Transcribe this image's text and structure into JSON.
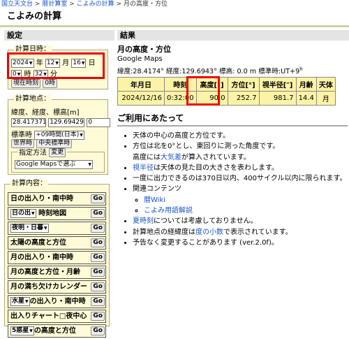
{
  "breadcrumb": {
    "items": [
      "国立天文台",
      "暦計算室",
      "こよみの計算"
    ],
    "sep": ">",
    "current": "月の高度・方位"
  },
  "page_title": "こよみの計算",
  "left_header": "設定",
  "right_header": "結果",
  "datetime": {
    "legend": "計算日時：",
    "year": "2024",
    "year_unit": "年",
    "month": "12",
    "month_unit": "月",
    "day": "16",
    "day_unit": "日",
    "hour": "0",
    "hour_unit": "時",
    "minute": "32",
    "minute_unit": "分",
    "now_button": "現在時刻",
    "zero_button": "0時"
  },
  "location": {
    "legend": "計算地点：",
    "label": "緯度、経度、標高[m]",
    "lat": "28.41737159",
    "lon": "129.6942901",
    "elev": "0",
    "tz_label": "標準時",
    "tz_value": "+09時間(日本)",
    "world_time_button": "世界時",
    "central_std_button": "中央標準時",
    "method_legend": "指定方法",
    "change_button": "変更",
    "method_value": "Google Mapsで選ぶ"
  },
  "contents": {
    "legend": "計算内容：",
    "go": "Go",
    "items": [
      {
        "label": "日の出入り・南中時",
        "select": ""
      },
      {
        "label": "時刻地図",
        "select": "日の出"
      },
      {
        "label": "",
        "select": "夜明・日暮"
      },
      {
        "label": "太陽の高度と方位",
        "select": ""
      },
      {
        "label": "月の出入り・南中時",
        "select": ""
      },
      {
        "label": "月の高度と方位・月齢",
        "select": ""
      },
      {
        "label": "月の満ち欠けカレンダー",
        "select": ""
      },
      {
        "label": "の出入り・南中時",
        "select": "水星"
      },
      {
        "label": "出入りチャート□夜中心",
        "select": ""
      },
      {
        "label": "の高度と方位",
        "select": "5惑星"
      }
    ]
  },
  "result": {
    "title": "月の高度・方位",
    "maps_link": "Google Maps",
    "params": "緯度:28.4174° 経度:129.6943° 標高: 0.0 m 標準時:UT+9",
    "params_sup": "h",
    "table": {
      "headers": [
        "年月日",
        "時刻",
        "高度[°]",
        "方位[°]",
        "視半径[″]",
        "月齢",
        "天体"
      ],
      "row": [
        "2024/12/16",
        "0:32:00",
        "90.0",
        "252.7",
        "981.7",
        "14.4",
        "月"
      ]
    }
  },
  "notes": {
    "title": "ご利用にあたって",
    "items": [
      {
        "text": "天体の中心の高度と方位です。"
      },
      {
        "text": "方位は北を0°とし、東回りに測った角度です。"
      },
      {
        "text_pre": "高度には",
        "link": "大気差",
        "text_post": "が算入されています。"
      },
      {
        "link": "視半径",
        "text_post": "は天体の見た目の大きさを表わします。"
      },
      {
        "text": "一度に出力できるのは370日以内、400サイクル以内に限られます。"
      },
      {
        "text": "関連コンテンツ"
      },
      {
        "link": "暦Wiki"
      },
      {
        "link": "こよみ用語解説"
      },
      {
        "link": "夏時刻",
        "text_post": "については考慮しておりません。"
      },
      {
        "text_pre": "計算地点の経緯度は",
        "link": "度の小数",
        "text_post": "で表示されています。"
      },
      {
        "text": "予告なく変更することがあります (ver.2.0f)。"
      }
    ]
  },
  "colors": {
    "highlight": "#ee0000",
    "panel_bg": "#fffbd6",
    "table_bg": "#fdf3a6",
    "link": "#1a55c9"
  }
}
